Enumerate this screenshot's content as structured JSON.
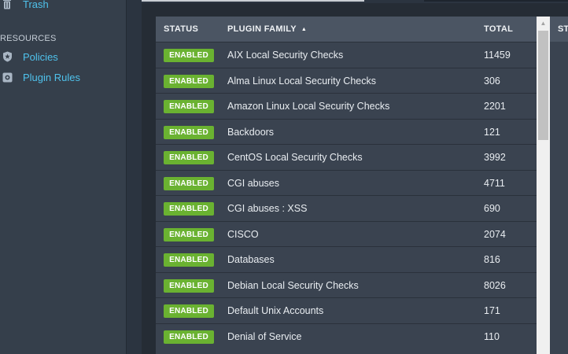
{
  "sidebar": {
    "items_top": [
      {
        "label": "Trash",
        "icon": "trash-icon"
      }
    ],
    "section_label": "RESOURCES",
    "items": [
      {
        "label": "Policies",
        "icon": "shield-icon"
      },
      {
        "label": "Plugin Rules",
        "icon": "plugin-rules-icon"
      }
    ]
  },
  "table": {
    "columns": {
      "status": "STATUS",
      "family": "PLUGIN FAMILY",
      "total": "TOTAL",
      "next": "STA"
    },
    "sort": "ascending",
    "rows": [
      {
        "status": "ENABLED",
        "family": "AIX Local Security Checks",
        "total": "11459"
      },
      {
        "status": "ENABLED",
        "family": "Alma Linux Local Security Checks",
        "total": "306"
      },
      {
        "status": "ENABLED",
        "family": "Amazon Linux Local Security Checks",
        "total": "2201"
      },
      {
        "status": "ENABLED",
        "family": "Backdoors",
        "total": "121"
      },
      {
        "status": "ENABLED",
        "family": "CentOS Local Security Checks",
        "total": "3992"
      },
      {
        "status": "ENABLED",
        "family": "CGI abuses",
        "total": "4711"
      },
      {
        "status": "ENABLED",
        "family": "CGI abuses : XSS",
        "total": "690"
      },
      {
        "status": "ENABLED",
        "family": "CISCO",
        "total": "2074"
      },
      {
        "status": "ENABLED",
        "family": "Databases",
        "total": "816"
      },
      {
        "status": "ENABLED",
        "family": "Debian Local Security Checks",
        "total": "8026"
      },
      {
        "status": "ENABLED",
        "family": "Default Unix Accounts",
        "total": "171"
      },
      {
        "status": "ENABLED",
        "family": "Denial of Service",
        "total": "110"
      }
    ]
  },
  "colors": {
    "accent": "#4fc2ec",
    "enabled_badge": "#6ab231",
    "header_bg": "#4b5563",
    "row_bg": "#3a4350"
  }
}
